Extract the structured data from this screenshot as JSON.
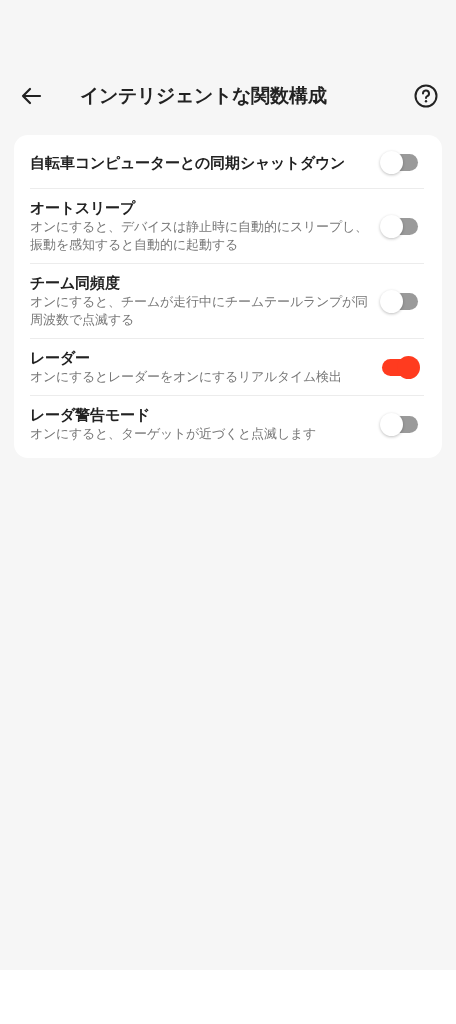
{
  "header": {
    "title": "インテリジェントな関数構成"
  },
  "settings": [
    {
      "title": "自転車コンピューターとの同期シャットダウン",
      "on": false
    },
    {
      "title": "オートスリープ",
      "description": "オンにすると、デバイスは静止時に自動的にスリープし、振動を感知すると自動的に起動する",
      "on": false
    },
    {
      "title": "チーム同頻度",
      "description": "オンにすると、チームが走行中にチームテールランプが同周波数で点滅する",
      "on": false
    },
    {
      "title": "レーダー",
      "description": "オンにするとレーダーをオンにするリアルタイム検出",
      "on": true
    },
    {
      "title": "レーダ警告モード",
      "description": "オンにすると、ターゲットが近づくと点滅します",
      "on": false
    }
  ]
}
